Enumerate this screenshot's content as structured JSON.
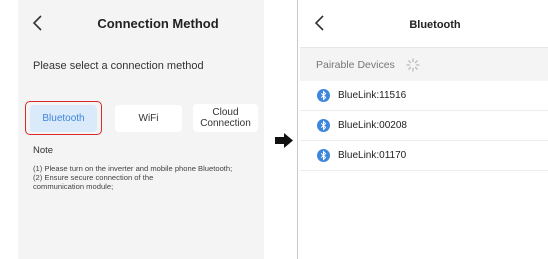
{
  "left": {
    "title": "Connection Method",
    "prompt": "Please select a connection method",
    "methods": [
      {
        "label": "Bluetooth"
      },
      {
        "label": "WiFi"
      },
      {
        "label_line1": "Cloud",
        "label_line2": "Connection"
      }
    ],
    "note_title": "Note",
    "note_lines": [
      "(1) Please turn on the inverter and mobile phone Bluetooth;",
      "(2) Ensure secure connection of the",
      "communication module;"
    ]
  },
  "right": {
    "title": "Bluetooth",
    "section_label": "Pairable Devices",
    "devices": [
      {
        "name": "BlueLink:11516"
      },
      {
        "name": "BlueLink:00208"
      },
      {
        "name": "BlueLink:01170"
      }
    ]
  },
  "colors": {
    "accent_blue": "#3d86de",
    "selected_bg": "#dbeafa",
    "highlight_red": "#d72a2a",
    "panel_bg": "#f4f4f4"
  },
  "icons": [
    "back-chevron-icon",
    "right-arrow-icon",
    "loading-spinner-icon",
    "bluetooth-icon"
  ]
}
